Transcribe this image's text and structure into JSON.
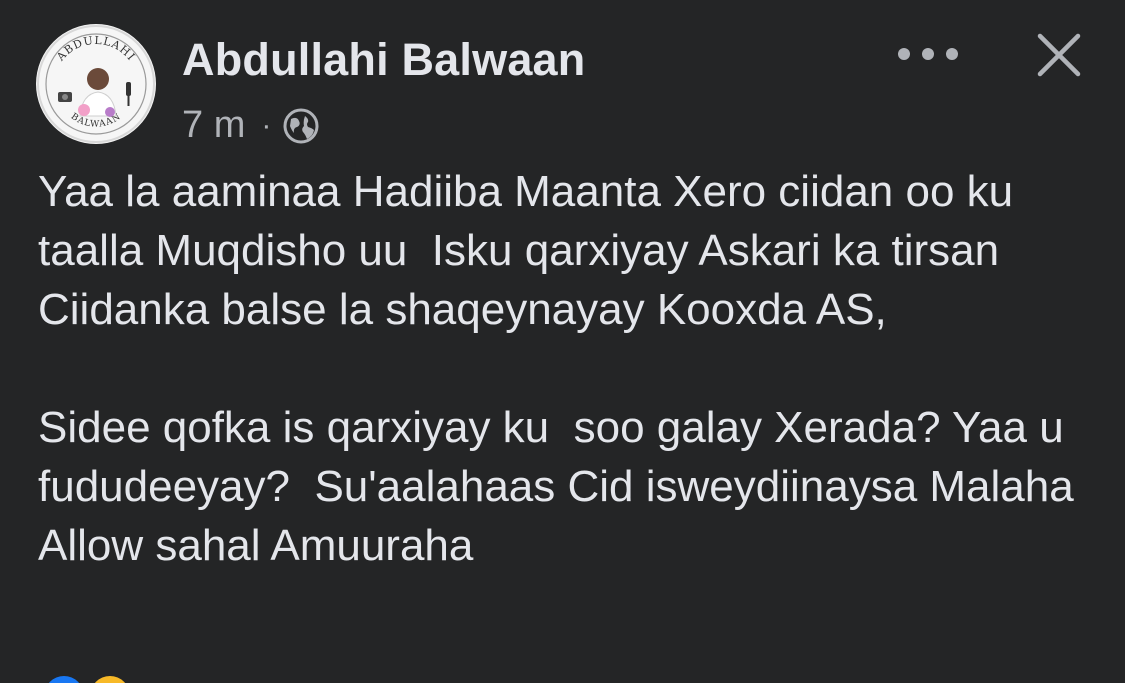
{
  "post": {
    "author": {
      "name": "Abdullahi Balwaan",
      "avatar_text_top": "ABDULLAHI",
      "avatar_text_bottom": "BALWAAN"
    },
    "meta": {
      "time": "7 m",
      "separator": "·",
      "audience_icon": "globe-icon"
    },
    "actions": {
      "more_icon": "more-horizontal-icon",
      "close_icon": "close-icon"
    },
    "text": "Yaa la aaminaa Hadiiba Maanta Xero ciidan oo ku taalla Muqdisho uu  Isku qarxiyay Askari ka tirsan Ciidanka balse la shaqeynayay Kooxda AS,\n\nSidee qofka is qarxiyay ku  soo galay Xerada? Yaa u fududeeyay?  Su'aalahaas Cid isweydiinaysa Malaha Allow sahal Amuuraha",
    "colors": {
      "background": "#242526",
      "primary_text": "#e4e6eb",
      "secondary_text": "#b0b3b8"
    }
  }
}
